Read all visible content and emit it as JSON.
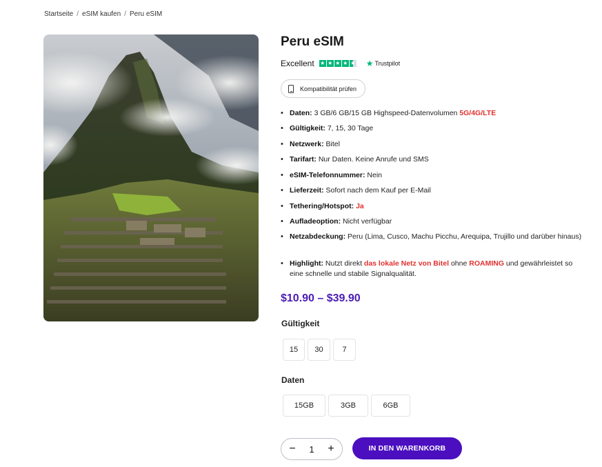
{
  "breadcrumb": {
    "home": "Startseite",
    "sep1": "/",
    "shop": "eSIM kaufen",
    "sep2": "/",
    "current": "Peru eSIM"
  },
  "product": {
    "title": "Peru eSIM",
    "rating_label": "Excellent",
    "rating_stars": 4.5,
    "trustpilot": "Trustpilot",
    "compat_button": "Kompatibilität prüfen"
  },
  "features": {
    "daten": {
      "label": "Daten:",
      "text": " 3 GB/6 GB/15 GB Highspeed-Datenvolumen ",
      "highlight": "5G/4G/LTE"
    },
    "gueltigkeit": {
      "label": "Gültigkeit:",
      "text": " 7, 15, 30 Tage"
    },
    "netzwerk": {
      "label": "Netzwerk:",
      "text": " Bitel"
    },
    "tarifart": {
      "label": "Tarifart:",
      "text": " Nur Daten. Keine Anrufe und SMS"
    },
    "nummer": {
      "label": "eSIM-Telefonnummer:",
      "text": " Nein"
    },
    "lieferzeit": {
      "label": "Lieferzeit:",
      "text": " Sofort nach dem Kauf per E-Mail"
    },
    "tethering": {
      "label": "Tethering/Hotspot:",
      "highlight": "Ja"
    },
    "aufladeoption": {
      "label": "Aufladeoption:",
      "text": " Nicht verfügbar"
    },
    "netzabdeckung": {
      "label": "Netzabdeckung:",
      "text": " Peru (Lima, Cusco, Machu Picchu, Arequipa, Trujillo und darüber hinaus)"
    },
    "highlight": {
      "label": "Highlight:",
      "text1": " Nutzt direkt ",
      "red1": "das lokale Netz von Bitel",
      "text2": " ohne ",
      "red2": "ROAMING",
      "text3": " und gewährleistet so eine schnelle und stabile Signalqualität."
    }
  },
  "price": "$10.90 – $39.90",
  "options": {
    "validity": {
      "label": "Gültigkeit",
      "values": [
        "15",
        "30",
        "7"
      ]
    },
    "data": {
      "label": "Daten",
      "values": [
        "15GB",
        "3GB",
        "6GB"
      ]
    }
  },
  "cart": {
    "minus": "−",
    "quantity": "1",
    "plus": "+",
    "add_label": "IN DEN WARENKORB"
  },
  "colors": {
    "accent": "#4b0fbf",
    "price": "#4a1bb5",
    "highlight_red": "#e0312f",
    "trustpilot_green": "#00b67a"
  }
}
